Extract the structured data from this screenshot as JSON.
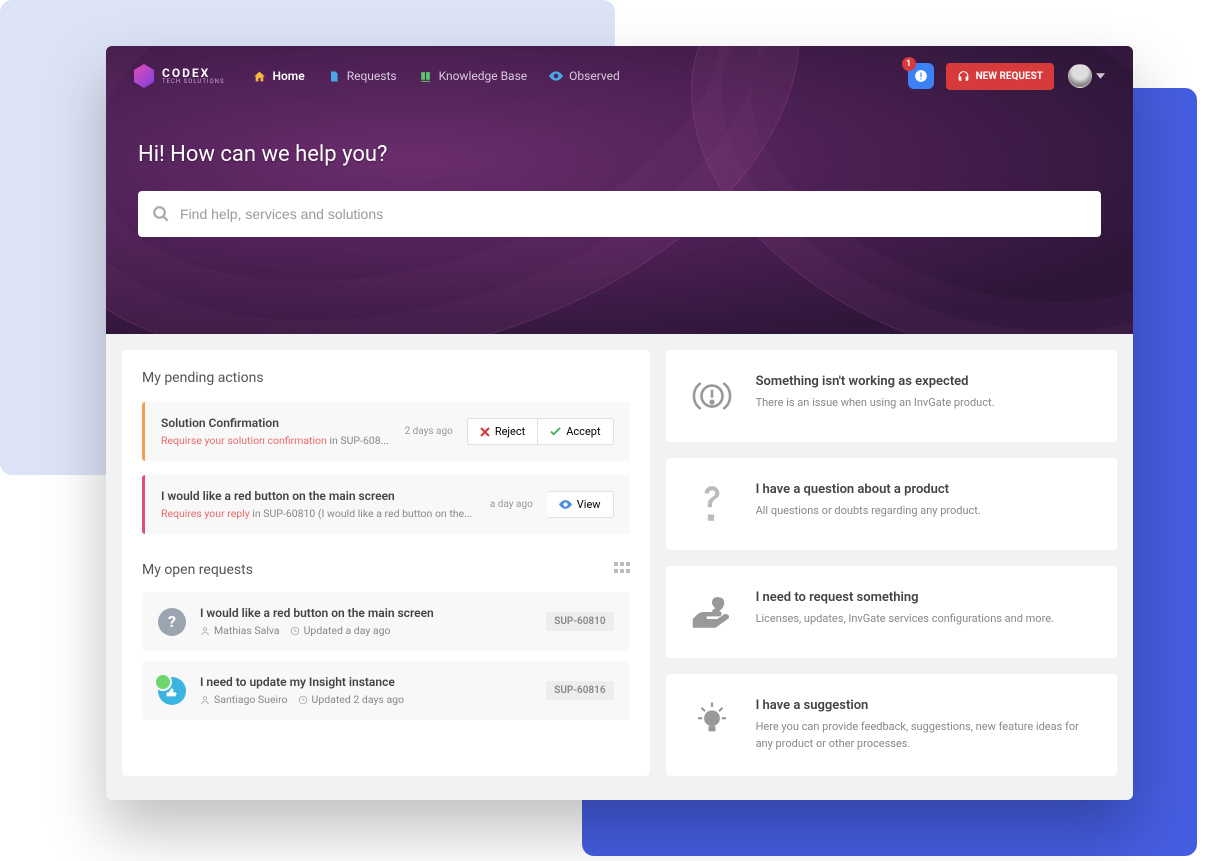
{
  "brand": {
    "name": "CODEX",
    "tagline": "TECH SOLUTIONS"
  },
  "nav": {
    "home": "Home",
    "requests": "Requests",
    "kb": "Knowledge Base",
    "observed": "Observed"
  },
  "notifications": {
    "count": "1"
  },
  "new_request_label": "NEW REQUEST",
  "hero": {
    "title": "Hi! How can we help you?",
    "placeholder": "Find help, services and solutions"
  },
  "pending": {
    "section_title": "My pending actions",
    "items": [
      {
        "title": "Solution Confirmation",
        "action_text": "Requirse your solution confirmation",
        "context": " in SUP-608...",
        "time": "2 days ago",
        "buttons": {
          "reject": "Reject",
          "accept": "Accept"
        }
      },
      {
        "title": "I would like a red button on the main screen",
        "action_text": "Requires your reply",
        "context": " in SUP-60810 (I would like a red button on the...",
        "time": "a day ago",
        "buttons": {
          "view": "View"
        }
      }
    ]
  },
  "open": {
    "section_title": "My open requests",
    "items": [
      {
        "title": "I would like a red button on the main screen",
        "author": "Mathias Salva",
        "updated": "Updated a day ago",
        "id": "SUP-60810"
      },
      {
        "title": "I need to update my Insight instance",
        "author": "Santiago Sueiro",
        "updated": "Updated 2 days ago",
        "id": "SUP-60816"
      }
    ]
  },
  "categories": [
    {
      "title": "Something isn't working as expected",
      "desc": "There is an issue when using an InvGate product."
    },
    {
      "title": "I have a question about a product",
      "desc": "All questions or doubts regarding any product."
    },
    {
      "title": "I need to request something",
      "desc": "Licenses, updates, InvGate services configurations and more."
    },
    {
      "title": "I have a suggestion",
      "desc": "Here you can provide feedback, suggestions, new feature ideas for any product or other processes."
    }
  ]
}
